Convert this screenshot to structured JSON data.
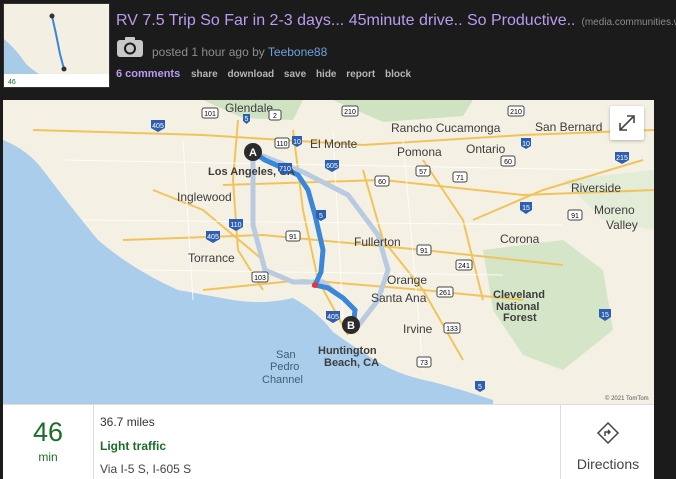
{
  "post": {
    "title": "RV 7.5 Trip So Far in 2-3 days... 45minute drive.. So Productive..",
    "domain": "(media.communities.win)",
    "posted_prefix": "posted ",
    "posted_time": "1 hour ago",
    "by_label": " by ",
    "author": "Teebone88",
    "comments": "6 comments",
    "actions": [
      "share",
      "download",
      "save",
      "hide",
      "report",
      "block"
    ]
  },
  "map": {
    "cities": {
      "glendale": "Glendale",
      "el_monte": "El Monte",
      "rancho": "Rancho Cucamonga",
      "san_bern": "San Bernard",
      "pomona": "Pomona",
      "ontario": "Ontario",
      "los_angeles": "Los Angeles, CA",
      "inglewood": "Inglewood",
      "riverside": "Riverside",
      "moreno1": "Moreno",
      "moreno2": "Valley",
      "fullerton": "Fullerton",
      "corona": "Corona",
      "torrance": "Torrance",
      "orange": "Orange",
      "santa_ana": "Santa Ana",
      "cleveland1": "Cleveland",
      "cleveland2": "National",
      "cleveland3": "Forest",
      "irvine": "Irvine",
      "san1": "San",
      "san2": "Pedro",
      "san3": "Channel",
      "hb1": "Huntington",
      "hb2": "Beach, CA"
    },
    "shields": {
      "s101": "101",
      "s5": "5",
      "s210a": "210",
      "s2": "2",
      "s210b": "210",
      "s405": "405",
      "s10": "10",
      "s110": "110",
      "s605": "605",
      "s60": "60",
      "s57": "57",
      "s71": "71",
      "s215": "215",
      "s710": "710",
      "s15": "15",
      "s91": "91",
      "s405b": "405",
      "s110b": "110",
      "s91b": "91",
      "s91c": "91",
      "s103": "103",
      "s241": "241",
      "s261": "261",
      "s405c": "405",
      "s5b": "5",
      "s133": "133",
      "s15b": "15",
      "s73": "73",
      "s5c": "5",
      "s60b": "60",
      "s10b": "10"
    },
    "marker_a": "A",
    "marker_b": "B",
    "copyright": "© 2021 TomTom"
  },
  "route": {
    "minutes": "46",
    "minutes_unit": "min",
    "distance": "36.7 miles",
    "traffic": "Light traffic",
    "via": "Via I-5 S, I-605 S",
    "directions_label": "Directions"
  },
  "colors": {
    "route": "#3a86d8",
    "traffic_green": "#1b6e2a",
    "title": "#b99bf0",
    "author": "#6fa1dc"
  },
  "icons": [
    "camera-icon",
    "expand-icon",
    "directions-icon"
  ]
}
